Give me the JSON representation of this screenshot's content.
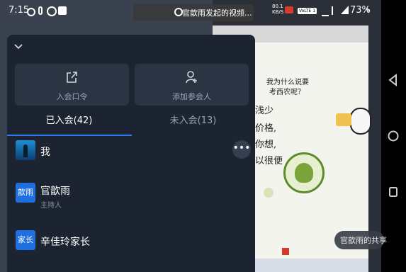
{
  "status_bar": {
    "time": "7:15",
    "notification_text": "官歆雨发起的视频...",
    "net_speed": "80.1 KB/S",
    "network_type": "VoLTE 1",
    "battery": "73%"
  },
  "slide": {
    "title_line1": "我为什么说要",
    "title_line2": "考西农呢？",
    "text_lines": [
      "浅少",
      "价格,",
      "你想,",
      "以很便"
    ]
  },
  "panel": {
    "actions": [
      {
        "label": "入会口令",
        "icon": "share-out-icon"
      },
      {
        "label": "添加参会人",
        "icon": "add-person-icon"
      }
    ],
    "tabs": [
      {
        "label": "已入会(42)",
        "active": true
      },
      {
        "label": "未入会(13)",
        "active": false
      }
    ],
    "participants": [
      {
        "name": "我",
        "role": "",
        "avatar_text": ""
      },
      {
        "name": "官歆雨",
        "role": "主持人",
        "avatar_text": "歆雨"
      },
      {
        "name": "辛佳玲家长",
        "role": "",
        "avatar_text": "家长"
      }
    ],
    "more_label": "•••"
  },
  "share_chip": "官歆雨的共享",
  "colors": {
    "panel_bg": "#1b2430",
    "accent": "#2a7cf0",
    "avatar_blue": "#1f6fe0"
  }
}
